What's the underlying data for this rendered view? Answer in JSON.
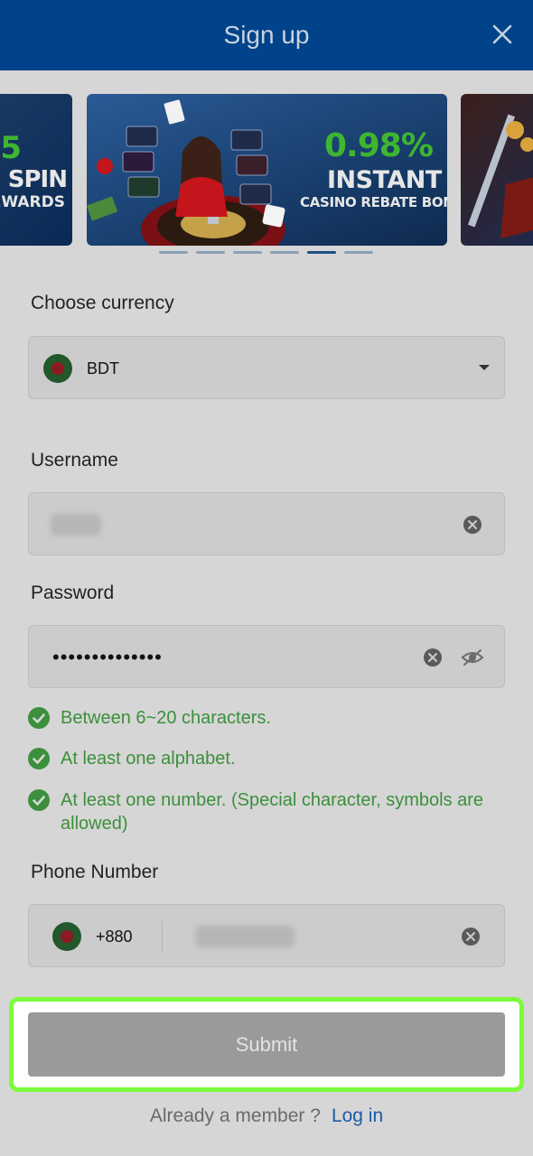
{
  "header": {
    "title": "Sign up",
    "close_icon": "close-icon"
  },
  "carousel": {
    "slides": [
      {
        "line1": "5",
        "line2": "EE SPIN",
        "line3": "REWARDS"
      },
      {
        "line1": "0.98%",
        "line2": "INSTANT",
        "line3": "CASINO REBATE BONUS"
      },
      {
        "line1": "",
        "line2": "",
        "line3": ""
      }
    ],
    "dot_count": 6,
    "active_dot": 5
  },
  "currency": {
    "label": "Choose currency",
    "value": "BDT",
    "flag_icon": "bangladesh-flag-icon",
    "dropdown_icon": "chevron-down-icon"
  },
  "username": {
    "label": "Username",
    "value": ""
  },
  "password": {
    "label": "Password",
    "masked_value": "••••••••••••••"
  },
  "password_rules": [
    "Between 6~20 characters.",
    "At least one alphabet.",
    "At least one number. (Special character, symbols are allowed)"
  ],
  "phone": {
    "label": "Phone Number",
    "country_code": "+880",
    "value": ""
  },
  "submit": {
    "label": "Submit"
  },
  "footer": {
    "prompt": "Already a member ?",
    "login_link": "Log in"
  },
  "colors": {
    "header_bg": "#00438a",
    "rule_green": "#3c8f3c",
    "highlight": "#7cfc3a",
    "link_blue": "#1d5aa8"
  }
}
